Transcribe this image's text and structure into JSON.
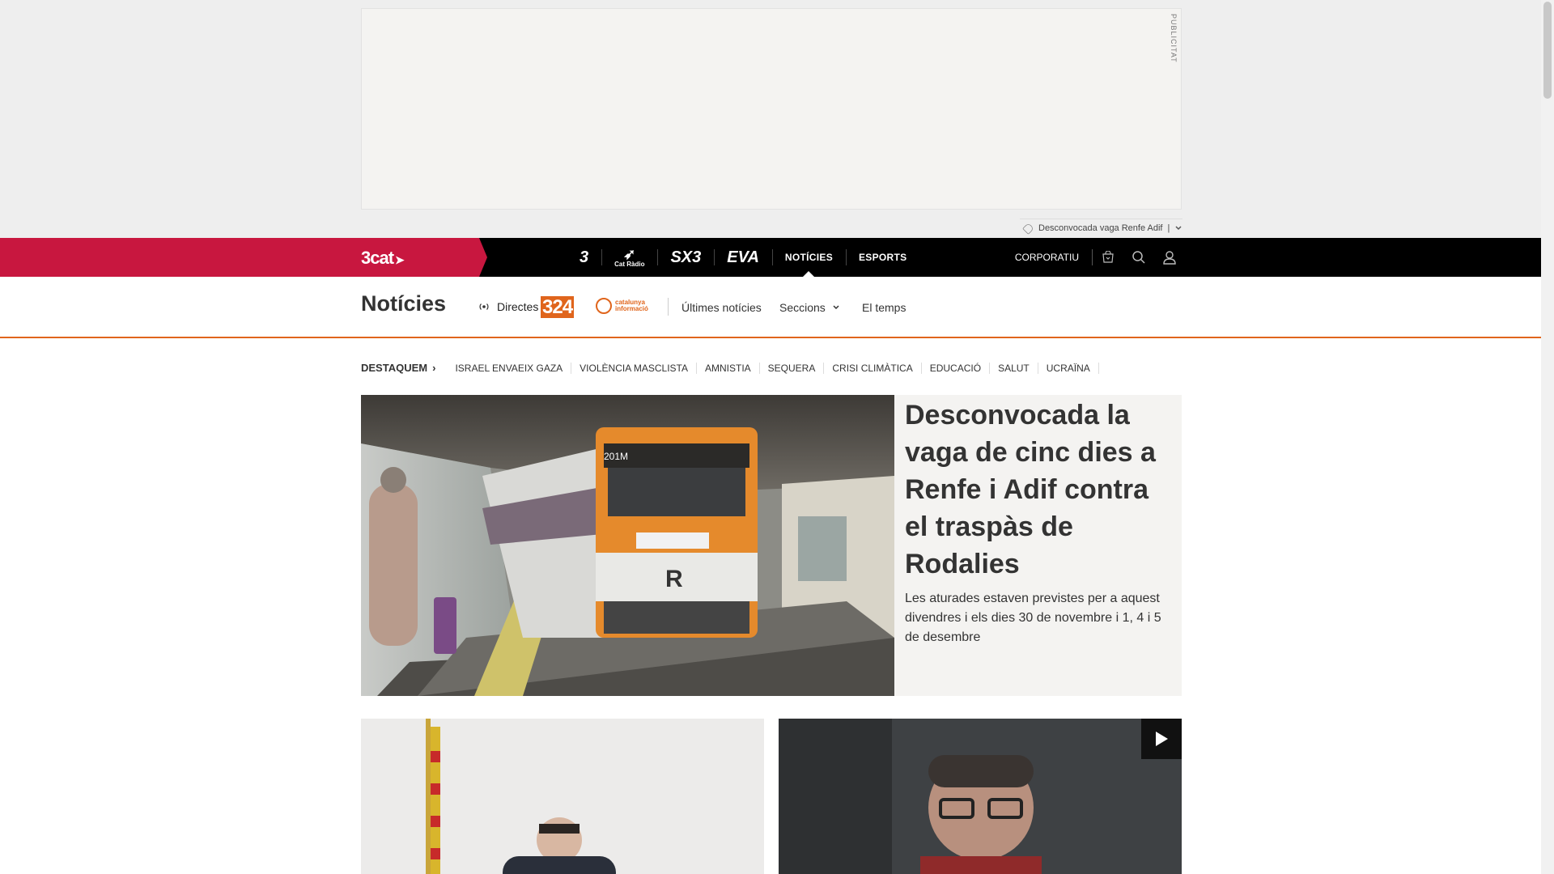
{
  "ad": {
    "label": "PUBLICITAT"
  },
  "hot_topic": {
    "text": "Desconvocada vaga Renfe Adif",
    "separator": "|"
  },
  "topnav": {
    "brand": "3cat",
    "channels": [
      "3",
      "Cat Ràdio",
      "SX3",
      "EVA"
    ],
    "links": [
      "NOTÍCIES",
      "ESPORTS"
    ],
    "active": "NOTÍCIES",
    "corporate": "CORPORATIU",
    "icons": [
      "cart-icon",
      "search-icon",
      "user-icon"
    ]
  },
  "section": {
    "title": "Notícies",
    "directes": "Directes",
    "logo_324": "324",
    "logo_ci_line1": "catalunya",
    "logo_ci_line2": "informació",
    "links": [
      "Últimes notícies",
      "Seccions",
      "El temps"
    ]
  },
  "destaquem": {
    "label": "DESTAQUEM",
    "topics": [
      "ISRAEL ENVAEIX GAZA",
      "VIOLÈNCIA MASCLISTA",
      "AMNISTIA",
      "SEQUERA",
      "CRISI CLIMÀTICA",
      "EDUCACIÓ",
      "SALUT",
      "UCRAÏNA"
    ]
  },
  "hero": {
    "title": "Desconvocada la vaga de cinc dies a Renfe i Adif contra el traspàs de Rodalies",
    "subtitle": "Les aturades estaven previstes per a aquest divendres i els dies 30 de novembre i 1, 4 i 5 de desembre",
    "train_code": "201M",
    "train_letter": "R"
  },
  "colors": {
    "brand": "#c8173f",
    "accent": "#e0651c",
    "nav_bg": "#000000"
  }
}
